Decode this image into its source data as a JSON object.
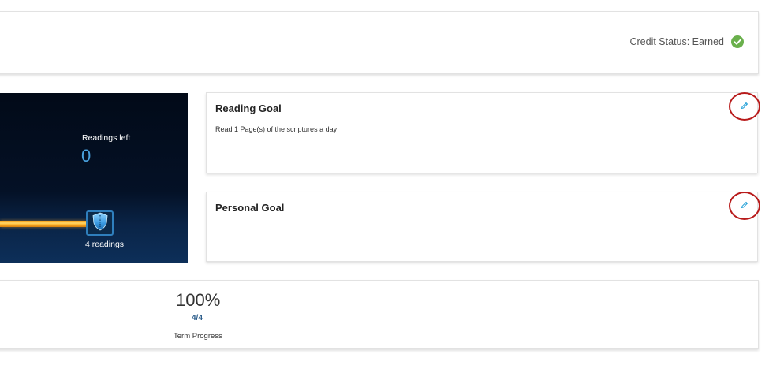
{
  "credit": {
    "status_text": "Credit Status: Earned",
    "status_icon": "check-circle-icon",
    "status_color": "#6ab04c"
  },
  "readings": {
    "left_label": "Readings left",
    "left_value": "0",
    "milestone_label": "4 readings",
    "milestone_icon": "shield-icon",
    "track_color": "#ffb42a",
    "value_color": "#4aa3e0"
  },
  "reading_goal": {
    "title": "Reading Goal",
    "text": "Read 1 Page(s) of the scriptures a day",
    "edit_icon": "pencil-icon"
  },
  "personal_goal": {
    "title": "Personal Goal",
    "text": "",
    "edit_icon": "pencil-icon"
  },
  "term": {
    "percent": "100%",
    "count": "4/4",
    "label": "Term Progress"
  },
  "colors": {
    "edit_icon": "#2aa3d9",
    "annotation_circle": "#b81a1a",
    "term_count": "#2b5c8a"
  }
}
